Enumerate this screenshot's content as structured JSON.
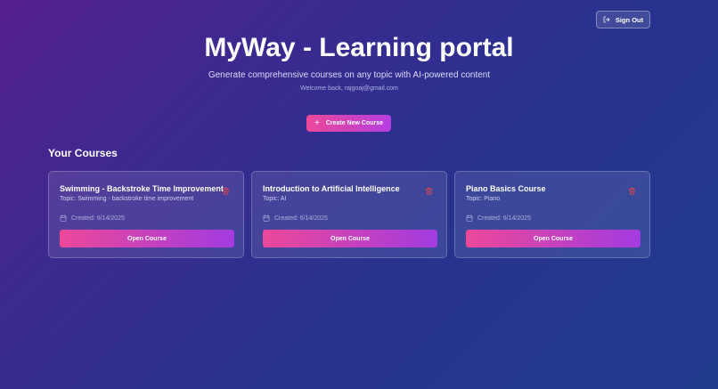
{
  "header": {
    "signout_label": "Sign Out",
    "title": "MyWay - Learning portal",
    "subtitle": "Generate comprehensive courses on any topic with AI-powered content",
    "welcome": "Welcome back, rajgoaj@gmail.com",
    "create_label": "Create New Course"
  },
  "courses_section": {
    "title": "Your Courses",
    "open_label": "Open Course",
    "items": [
      {
        "title": "Swimming - Backstroke Time Improvement",
        "topic": "Topic: Swimming - backstroke time improvement",
        "created": "Created: 6/14/2025"
      },
      {
        "title": "Introduction to Artificial Intelligence",
        "topic": "Topic: AI",
        "created": "Created: 6/14/2025"
      },
      {
        "title": "Piano Basics Course",
        "topic": "Topic: Piano",
        "created": "Created: 6/14/2025"
      }
    ]
  },
  "icons": {
    "signout": "log-out-icon",
    "create": "plus-icon",
    "delete": "trash-icon",
    "calendar": "calendar-icon"
  },
  "colors": {
    "accent_start": "#ec4899",
    "accent_end": "#a23be0",
    "delete": "#ef4444"
  }
}
